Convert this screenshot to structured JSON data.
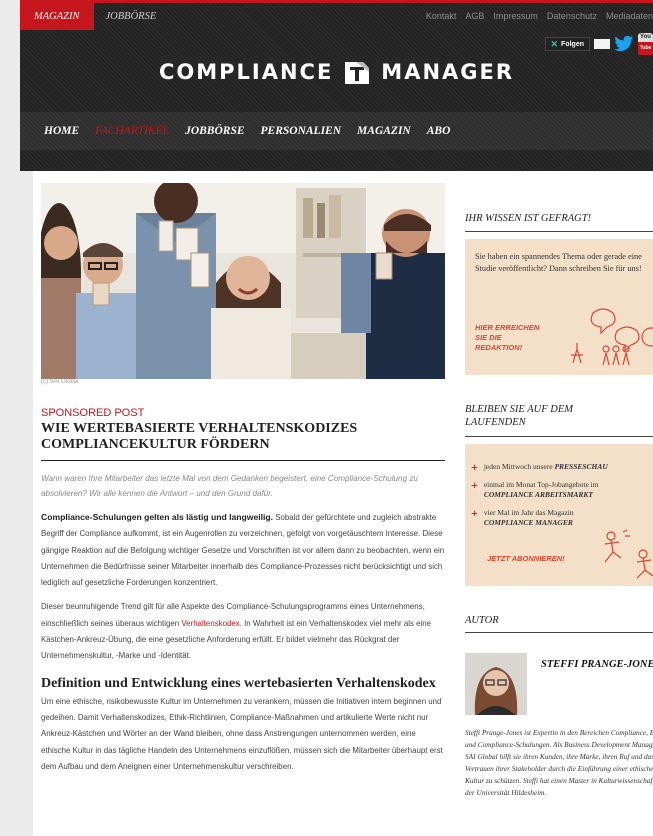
{
  "topbar": {
    "sections": [
      "MAGAZIN",
      "JOBBÖRSE"
    ],
    "links": [
      "Kontakt",
      "AGB",
      "Impressum",
      "Datenschutz",
      "Mediadaten"
    ]
  },
  "social": {
    "xing_label": "Folgen",
    "youtube_top": "You",
    "youtube_bottom": "Tube"
  },
  "brand": {
    "left": "COMPLIANCE",
    "right": "MANAGER"
  },
  "nav": [
    "HOME",
    "FACHARTIKEL",
    "JOBBÖRSE",
    "PERSONALIEN",
    "MAGAZIN",
    "ABO"
  ],
  "article": {
    "image_credit": "(c) SAI Global",
    "kicker": "SPONSORED POST",
    "headline": "WIE WERTEBASIERTE VERHALTENSKODIZES COMPLIANCEKULTUR FÖRDERN",
    "lede": "Wann waren Ihre Mitarbeiter das letzte Mal von dem Gedanken begeistert, eine Compliance-Schulung zu absolvieren? Wir alle kennen die Antwort – und den Grund dafür.",
    "p1_bold": "Compliance-Schulungen gelten als lästig und langweilig.",
    "p1_rest": " Sobald der gefürchtete und zugleich abstrakte Begriff der Compliance aufkommt, ist ein Augenrollen zu verzeichnen, gefolgt von vorgetäuschtem Interesse. Diese gängige Reaktion auf die Befolgung wichtiger Gesetze und Vorschriften ist vor allem dann zu beobachten, wenn ein Unternehmen die Bedürfnisse seiner Mitarbeiter innerhalb des Compliance-Prozesses nicht berücksichtigt und sich lediglich auf gesetzliche Forderungen konzentriert.",
    "p2_a": "Dieser beunruhigende Trend gilt für alle Aspekte des Compliance-Schulungsprogramms eines Unternehmens, einschließlich seines überaus wichtigen ",
    "p2_link": "Verhaltenskodex",
    "p2_b": ". In Wahrheit ist ein Verhaltenskodex viel mehr als eine Kästchen-Ankreuz-Übung, die eine gesetzliche Anforderung erfüllt. Er bildet vielmehr das Rückgrat der Unternehmenskultur, -Marke und -Identität.",
    "h2": "Definition und Entwicklung eines wertebasierten Verhaltenskodex",
    "p3": "Um eine ethische, risikobewusste Kultur im Unternehmen zu verankern, müssen die Initiativen intern beginnen und gedeihen. Damit Verhaltenskodizes, Ethik-Richtlinien, Compliance-Maßnahmen und artikulierte Werte nicht nur Ankreuz-Kästchen und Wörter an der Wand bleiben, ohne dass Anstrengungen unternommen werden, eine ethische Kultur in das tägliche Handeln des Unternehmens einzuflößen, müssen sich die Mitarbeiter überhaupt erst dem Aufbau und dem Aneignen einer Unternehmenskultur verschreiben."
  },
  "sidebar": {
    "box1": {
      "heading": "IHR WISSEN IST GEFRAGT!",
      "text": "Sie haben ein spannendes Thema oder gerade eine Studie veröffentlicht? Dann schreiben Sie für uns!",
      "cta_1": "HIER ERREICHEN",
      "cta_2": "SIE DIE",
      "cta_3": "REDAKTION!"
    },
    "box2": {
      "heading_1": "BLEIBEN SIE AUF DEM",
      "heading_2": "LAUFENDEN",
      "item1_pre": "jeden Mittwoch unsere ",
      "item1_bold": "PRESSESCHAU",
      "item2_pre": "einmal im Monat Top-Jobangebote im",
      "item2_bold": "COMPLIANCE ARBEITSMARKT",
      "item3_pre": "vier Mal im Jahr das Magazin",
      "item3_bold": "COMPLIANCE MANAGER",
      "cta": "JETZT ABONNIEREN!"
    },
    "author": {
      "heading": "AUTOR",
      "name": "STEFFI PRANGE-JONES",
      "bio": "Steffi Prange-Jones ist Expertin in den Bereichen Compliance, Ethik und Compliance-Schulungen. Als Business Development Manager bei SAI Global hilft sie ihren Kunden, ihre Marke, ihren Ruf und das Vertrauen ihrer Stakeholder durch die Einführung einer ethischen Kultur zu schützen. Steffi hat einen Master in Kulturwissenschaften der Universität Hildesheim."
    }
  }
}
